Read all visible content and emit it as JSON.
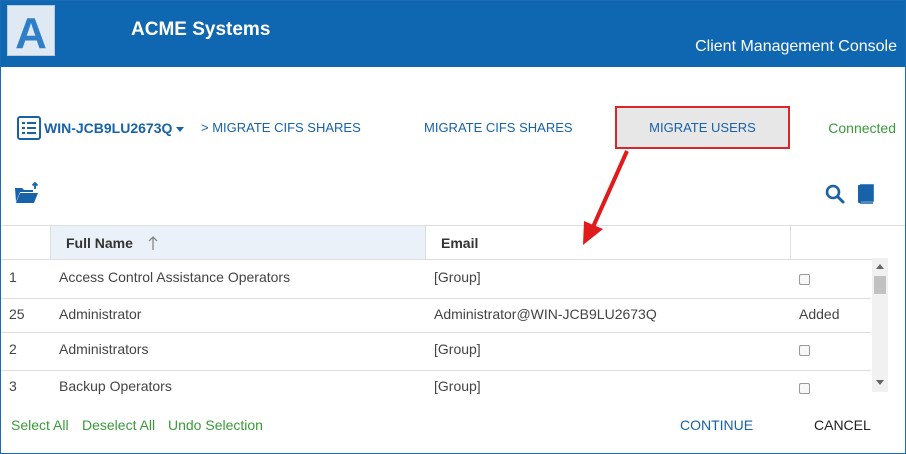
{
  "header": {
    "logo_letter": "A",
    "app_name": "ACME Systems",
    "console_title": "Client Management Console",
    "color": "#0f67b1"
  },
  "toolbar": {
    "server_name": "WIN-JCB9LU2673Q",
    "breadcrumb": "> MIGRATE CIFS SHARES",
    "nav_cifs": "MIGRATE CIFS SHARES",
    "nav_users": "MIGRATE USERS",
    "status": "Connected",
    "icons": [
      "server-list-icon",
      "folder-upload-icon",
      "search-icon",
      "book-icon"
    ]
  },
  "table": {
    "columns": [
      "Full Name",
      "Email"
    ],
    "sort_icon": "sort-ascending-icon",
    "rows": [
      {
        "num": "1",
        "name": "Access Control Assistance Operators",
        "email": "[Group]",
        "status": "",
        "checked": false
      },
      {
        "num": "25",
        "name": "Administrator",
        "email": "Administrator@WIN-JCB9LU2673Q",
        "status": "Added",
        "checked": false
      },
      {
        "num": "2",
        "name": "Administrators",
        "email": "[Group]",
        "status": "",
        "checked": false
      },
      {
        "num": "3",
        "name": "Backup Operators",
        "email": "[Group]",
        "status": "",
        "checked": false
      }
    ]
  },
  "footer": {
    "select_all": "Select All",
    "deselect_all": "Deselect All",
    "undo_selection": "Undo Selection",
    "continue": "CONTINUE",
    "cancel": "CANCEL"
  },
  "colors": {
    "accent": "#1762a8",
    "highlight_border": "#d9262b",
    "status_green": "#3a9a3a"
  }
}
